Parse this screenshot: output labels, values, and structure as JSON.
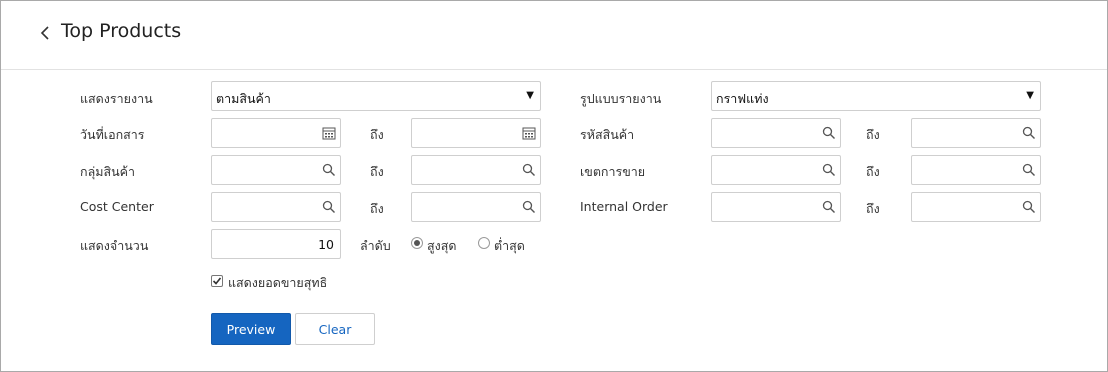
{
  "header": {
    "title": "Top Products"
  },
  "form": {
    "report_by": {
      "label": "แสดงรายงาน",
      "value": "ตามสินค้า"
    },
    "report_format": {
      "label": "รูปแบบรายงาน",
      "value": "กราฟแท่ง"
    },
    "doc_date": {
      "label": "วันที่เอกสาร",
      "to_label": "ถึง"
    },
    "product_code": {
      "label": "รหัสสินค้า",
      "to_label": "ถึง"
    },
    "product_group": {
      "label": "กลุ่มสินค้า",
      "to_label": "ถึง"
    },
    "sales_area": {
      "label": "เขตการขาย",
      "to_label": "ถึง"
    },
    "cost_center": {
      "label": "Cost Center",
      "to_label": "ถึง"
    },
    "internal_order": {
      "label": "Internal Order",
      "to_label": "ถึง"
    },
    "show_count": {
      "label": "แสดงจำนวน",
      "value": "10"
    },
    "order": {
      "label": "ลำดับ",
      "options": [
        "สูงสุด",
        "ต่ำสุด"
      ],
      "selected": "สูงสุด"
    },
    "net_sales": {
      "label": "แสดงยอดขายสุทธิ",
      "checked": true
    }
  },
  "buttons": {
    "preview": "Preview",
    "clear": "Clear"
  },
  "colors": {
    "primary": "#1565c0",
    "border": "#cfcfcf"
  },
  "icons": {
    "calendar": "calendar-icon",
    "search": "search-icon",
    "back": "chevron-left-icon"
  }
}
